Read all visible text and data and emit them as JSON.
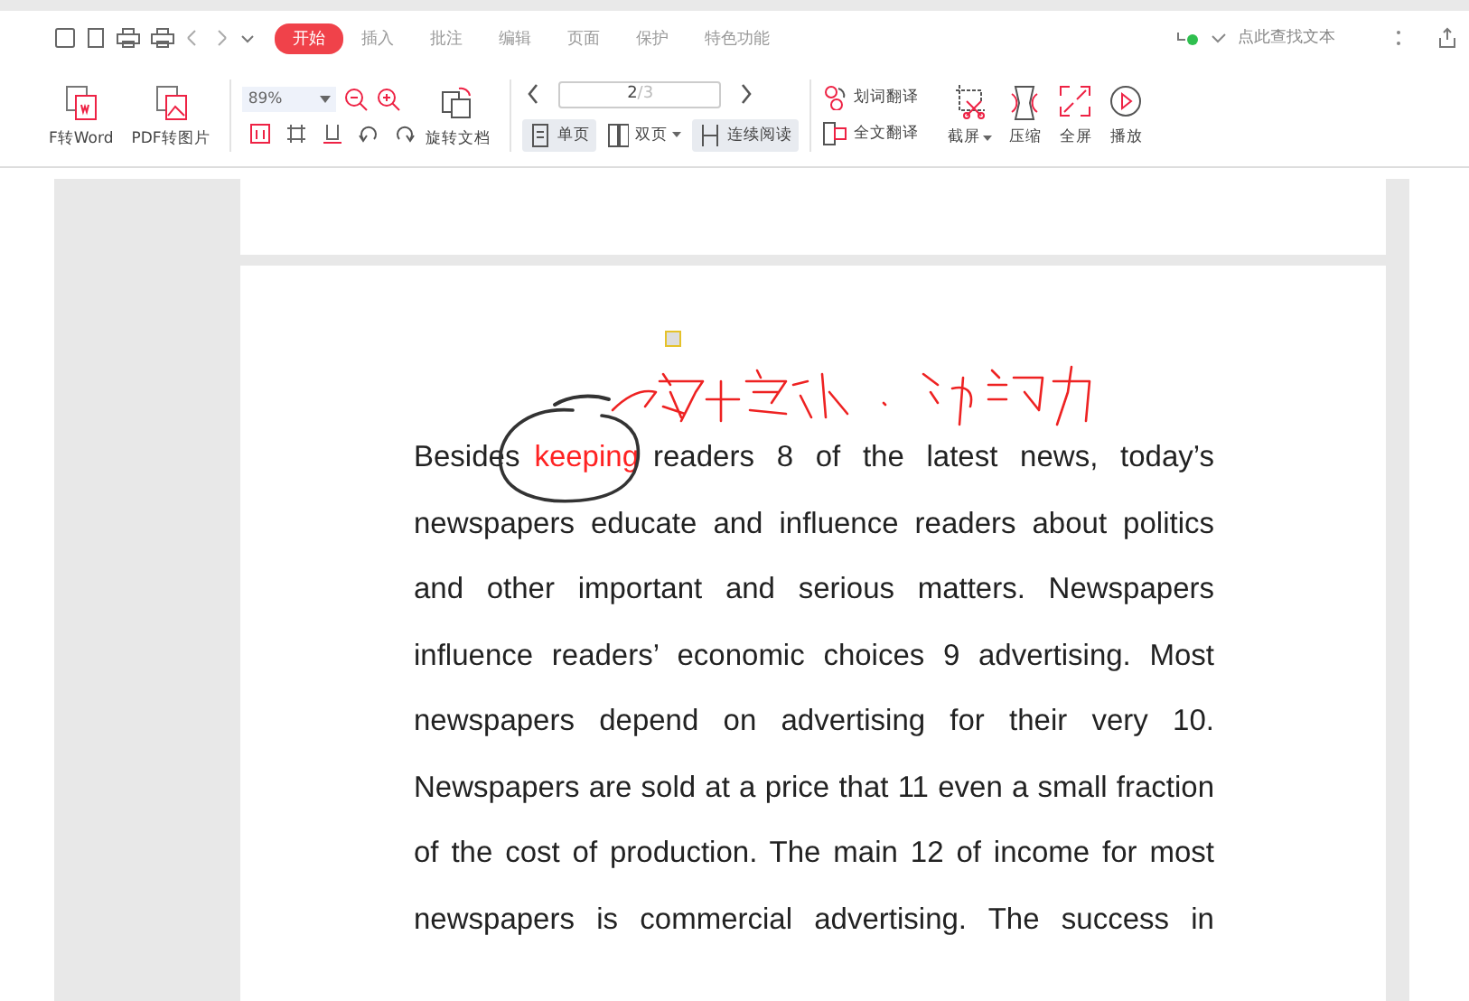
{
  "menu_tabs": [
    {
      "label": "开始",
      "selected": true
    },
    {
      "label": "插入",
      "selected": false
    },
    {
      "label": "批注",
      "selected": false
    },
    {
      "label": "编辑",
      "selected": false
    },
    {
      "label": "页面",
      "selected": false
    },
    {
      "label": "保护",
      "selected": false
    },
    {
      "label": "特色功能",
      "selected": false
    }
  ],
  "search": {
    "placeholder": "点此查找文本"
  },
  "toolbar": {
    "convert_buttons": [
      "F转Word",
      "PDF转图片"
    ],
    "zoom": "89%",
    "rotate_label": "旋转文档",
    "page_input": "2",
    "page_total": "/3",
    "view_modes": [
      {
        "label": "单页",
        "selected": true
      },
      {
        "label": "双页",
        "selected": false
      },
      {
        "label": "连续阅读",
        "selected": true
      }
    ],
    "translate": [
      "划词翻译",
      "全文翻译"
    ],
    "tools": [
      "截屏",
      "压缩",
      "全屏",
      "播放"
    ]
  },
  "document": {
    "lines": [
      {
        "before": "Besides",
        "highlight": "keeping",
        "after": "readers 8 of the latest news, today’s"
      },
      {
        "text": "newspapers educate and influence readers about politics"
      },
      {
        "text": "and other important and serious matters. Newspapers"
      },
      {
        "text": "influence readers’ economic choices 9 advertising. Most"
      },
      {
        "text": "newspapers depend on advertising for their very 10."
      },
      {
        "text": "Newspapers are sold at a price that 11 even a small fraction"
      },
      {
        "text": "of the cost of production. The main 12 of income for most"
      },
      {
        "text": "newspapers is commercial advertising. The success in"
      }
    ]
  }
}
